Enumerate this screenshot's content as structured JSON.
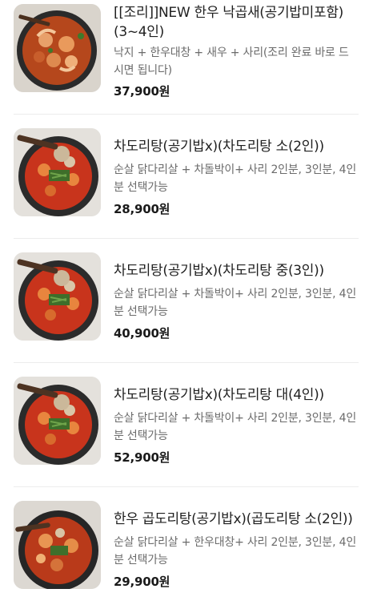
{
  "menu": {
    "items": [
      {
        "title": "[[조리]]NEW 한우 낙곱새(공기밥미포함)(3~4인)",
        "description": "낙지 + 한우대창 + 새우 + 사리(조리 완료 바로 드시면 됩니다)",
        "price": "37,900원",
        "image": "nakgopsae-photo"
      },
      {
        "title": "차도리탕(공기밥x)(차도리탕 소(2인))",
        "description": "순살 닭다리살 + 차돌박이+ 사리 2인분, 3인분, 4인분 선택가능",
        "price": "28,900원",
        "image": "chadoritang-photo"
      },
      {
        "title": "차도리탕(공기밥x)(차도리탕 중(3인))",
        "description": "순살 닭다리살 + 차돌박이+ 사리 2인분, 3인분, 4인분 선택가능",
        "price": "40,900원",
        "image": "chadoritang-photo"
      },
      {
        "title": "차도리탕(공기밥x)(차도리탕 대(4인))",
        "description": "순살 닭다리살 + 차돌박이+ 사리 2인분, 3인분, 4인분 선택가능",
        "price": "52,900원",
        "image": "chadoritang-photo"
      },
      {
        "title": "한우 곱도리탕(공기밥x)(곱도리탕 소(2인))",
        "description": "순살 닭다리살 + 한우대창+ 사리 2인분, 3인분, 4인분 선택가능",
        "price": "29,900원",
        "image": "gopdoritang-photo"
      }
    ]
  }
}
